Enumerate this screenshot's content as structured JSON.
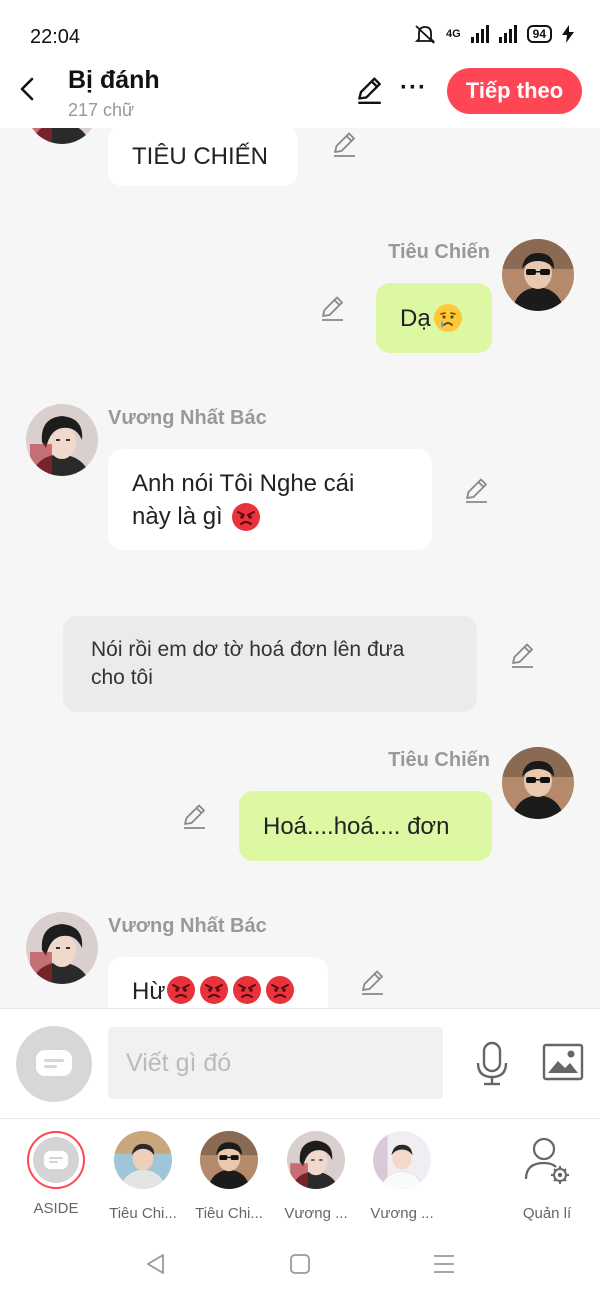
{
  "status_bar": {
    "time": "22:04",
    "network": "4G",
    "battery": "94"
  },
  "header": {
    "title": "Bị đánh",
    "subtitle": "217 chữ",
    "next_label": "Tiếp theo"
  },
  "messages": [
    {
      "text": "TIÊU CHIẾN"
    },
    {
      "sender": "Tiêu Chiến",
      "text": "Dạ"
    },
    {
      "sender": "Vương Nhất Bác",
      "text_line1": "Anh nói Tôi Nghe cái",
      "text_line2": "này là gì"
    },
    {
      "text_line1": "Nói rồi em dơ tờ hoá đơn lên đưa",
      "text_line2": "cho tôi"
    },
    {
      "sender": "Tiêu Chiến",
      "text": "Hoá....hoá.... đơn"
    },
    {
      "sender": "Vương Nhất Bác",
      "text": "Hừ"
    }
  ],
  "composer": {
    "placeholder": "Viết gì đó"
  },
  "roster": [
    {
      "label": "ASIDE"
    },
    {
      "label": "Tiêu Chi..."
    },
    {
      "label": "Tiêu Chi..."
    },
    {
      "label": "Vương ..."
    },
    {
      "label": "Vương ..."
    },
    {
      "label": "Quản lí"
    }
  ],
  "colors": {
    "accent": "#ff4655",
    "sent_bubble": "#dcf8a2",
    "received_bubble": "#ffffff",
    "narration_bubble": "#ebebeb"
  }
}
